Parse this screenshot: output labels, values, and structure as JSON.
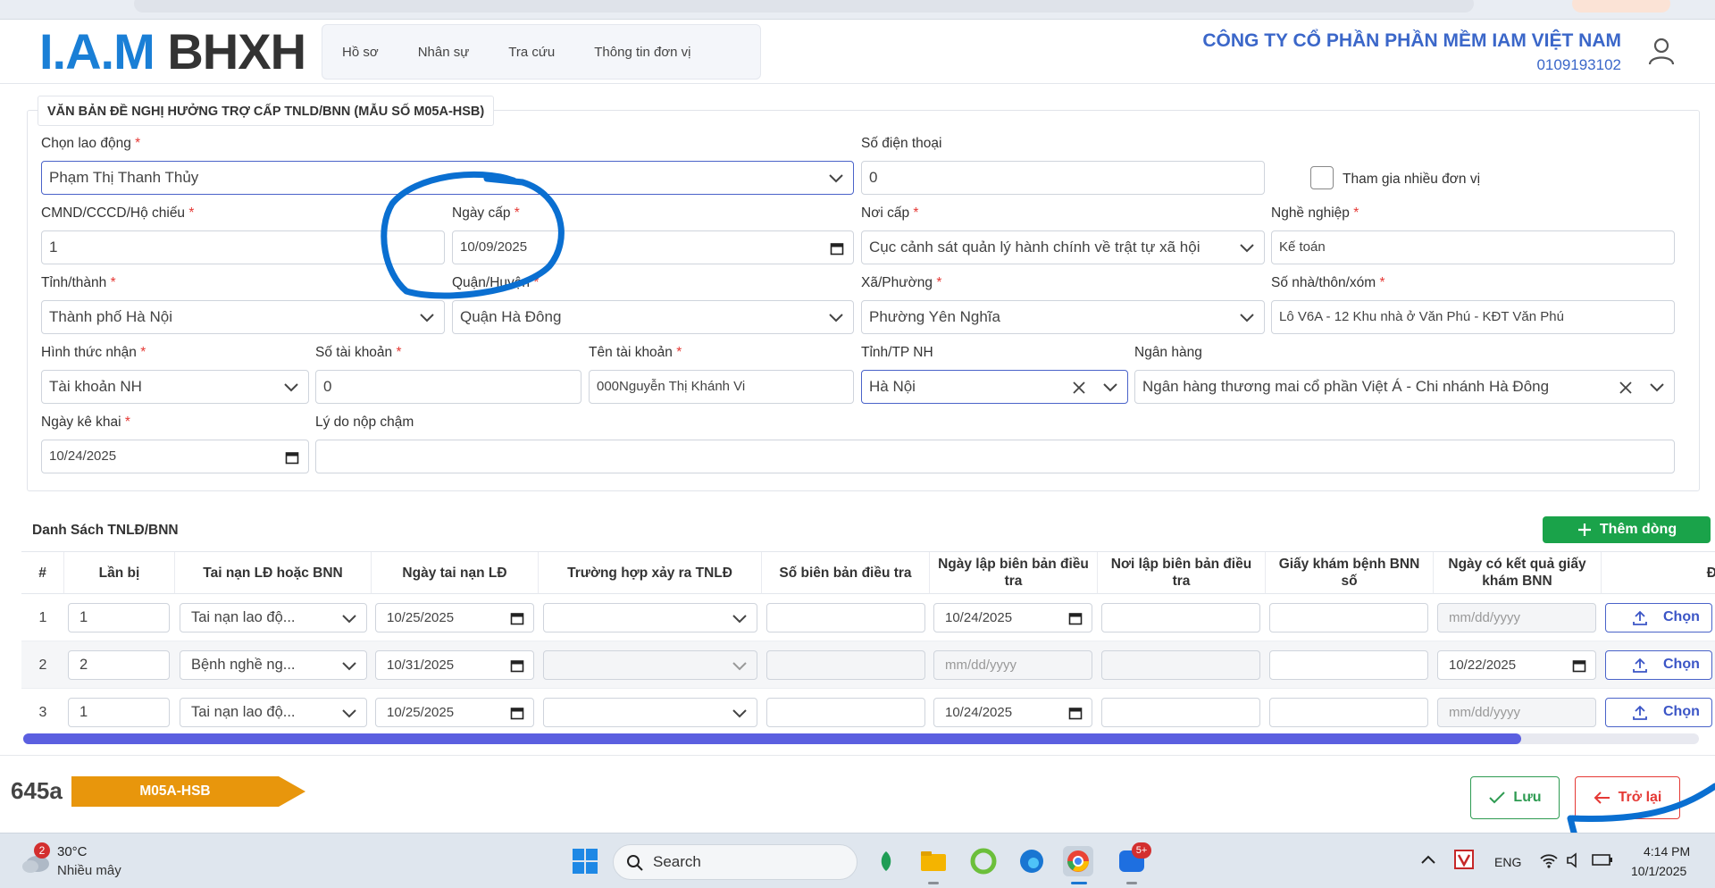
{
  "header": {
    "logo_part1": "I.A.M",
    "logo_part2": "BHXH",
    "nav": [
      "Hồ sơ",
      "Nhân sự",
      "Tra cứu",
      "Thông tin đơn vị"
    ],
    "company_name": "CÔNG TY CỔ PHẦN PHẦN MỀM IAM VIỆT NAM",
    "tax_code": "0109193102"
  },
  "form": {
    "title": "VĂN BẢN ĐỀ NGHỊ HƯỞNG TRỢ CẤP TNLD/BNN (MẪU SỐ M05A-HSB)",
    "required_mark": "*",
    "employee": {
      "label": "Chọn lao động",
      "value": "Phạm Thị Thanh Thủy"
    },
    "phone": {
      "label": "Số điện thoại",
      "value": "0"
    },
    "multi_unit": {
      "label": "Tham gia nhiều đơn vị",
      "checked": false
    },
    "id_number": {
      "label": "CMND/CCCD/Hộ chiếu",
      "value": "1"
    },
    "issue_date": {
      "label": "Ngày cấp",
      "value": "10/09/2025"
    },
    "issue_place": {
      "label": "Nơi cấp",
      "value": "Cục cảnh sát quản lý hành chính về trật tự xã hội"
    },
    "occupation": {
      "label": "Nghề nghiệp",
      "value": "Kế toán"
    },
    "province": {
      "label": "Tỉnh/thành",
      "value": "Thành phố Hà Nội"
    },
    "district": {
      "label": "Quận/Huyện",
      "value": "Quận Hà Đông"
    },
    "ward": {
      "label": "Xã/Phường",
      "value": "Phường Yên Nghĩa"
    },
    "address": {
      "label": "Số nhà/thôn/xóm",
      "value": "Lô V6A - 12 Khu nhà ở Văn Phú - KĐT Văn Phú"
    },
    "receive_method": {
      "label": "Hình thức nhận",
      "value": "Tài khoản NH"
    },
    "account_number": {
      "label": "Số tài khoản",
      "value": "0"
    },
    "account_name": {
      "label": "Tên tài khoản",
      "value": "000Nguyễn Thị Khánh Vi"
    },
    "bank_province": {
      "label": "Tỉnh/TP NH",
      "value": "Hà Nội"
    },
    "bank": {
      "label": "Ngân hàng",
      "value": "Ngân hàng thương mai cổ phần Việt Á - Chi nhánh Hà Đông"
    },
    "declare_date": {
      "label": "Ngày kê khai",
      "value": "10/24/2025"
    },
    "late_reason": {
      "label": "Lý do nộp chậm",
      "value": ""
    }
  },
  "table": {
    "title": "Danh Sách TNLĐ/BNN",
    "add_label": "Thêm dòng",
    "columns": [
      "#",
      "Lần bị",
      "Tai nạn LĐ hoặc BNN",
      "Ngày tai nạn LĐ",
      "Trường hợp xảy ra TNLĐ",
      "Số biên bản điều tra",
      "Ngày lập biên bản điều tra",
      "Nơi lập biên bản điều tra",
      "Giấy khám bệnh BNN số",
      "Ngày có kết quả giấy khám BNN",
      "Đ"
    ],
    "choose_label": "Chọn",
    "date_placeholder": "mm/dd/yyyy",
    "rows": [
      {
        "num": "1",
        "times": "1",
        "type": "Tai nạn lao độ...",
        "accident_date": "10/25/2025",
        "case": "",
        "report_no": "",
        "report_date": "10/24/2025",
        "report_place": "",
        "cert_no": "",
        "result_date": ""
      },
      {
        "num": "2",
        "times": "2",
        "type": "Bệnh nghề ng...",
        "accident_date": "10/31/2025",
        "case": "",
        "report_no": "",
        "report_date": "",
        "report_place": "",
        "cert_no": "",
        "result_date": "10/22/2025"
      },
      {
        "num": "3",
        "times": "1",
        "type": "Tai nạn lao độ...",
        "accident_date": "10/25/2025",
        "case": "",
        "report_no": "",
        "report_date": "10/24/2025",
        "report_place": "",
        "cert_no": "",
        "result_date": ""
      }
    ],
    "scroll_fraction": 0.894
  },
  "footer": {
    "doc_code": "645a",
    "form_code": "M05A-HSB",
    "save_label": "Lưu",
    "back_label": "Trở lại"
  },
  "taskbar": {
    "weather_temp": "30°C",
    "weather_desc": "Nhiều mây",
    "weather_badge": "2",
    "search_label": "Search",
    "zalo_badge": "5+",
    "lang": "ENG",
    "time": "4:14 PM",
    "date": "10/1/2025"
  },
  "colors": {
    "brand_blue": "#1a7fd6",
    "company_blue": "#3b67c9",
    "required_red": "#e53935",
    "add_green": "#1aa34a",
    "badge_orange": "#e8960c",
    "annotation_blue": "#0a6fd1"
  },
  "icons": [
    "user-icon",
    "chevron-down-icon",
    "calendar-icon",
    "close-icon",
    "plus-icon",
    "upload-icon",
    "check-icon",
    "arrow-left-icon",
    "windows-start-icon",
    "search-icon",
    "weather-icon"
  ]
}
